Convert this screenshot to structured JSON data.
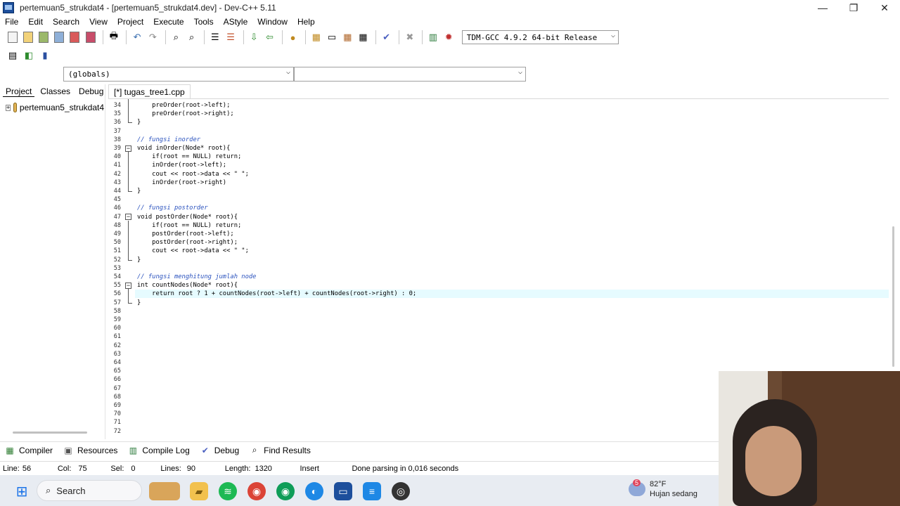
{
  "window": {
    "title": "pertemuan5_strukdat4 - [pertemuan5_strukdat4.dev] - Dev-C++ 5.11",
    "min_glyph": "—",
    "max_glyph": "❐",
    "close_glyph": "✕"
  },
  "menu": [
    "File",
    "Edit",
    "Search",
    "View",
    "Project",
    "Execute",
    "Tools",
    "AStyle",
    "Window",
    "Help"
  ],
  "toolbar": {
    "compiler": "TDM-GCC 4.9.2 64-bit Release"
  },
  "scope": {
    "left": "(globals)",
    "right": ""
  },
  "left_panel": {
    "tabs": [
      "Project",
      "Classes",
      "Debug"
    ],
    "project_name": "pertemuan5_strukdat4"
  },
  "editor": {
    "tab": "[*] tugas_tree1.cpp",
    "lines": [
      {
        "n": "34",
        "t": "    preOrder(root->left);"
      },
      {
        "n": "35",
        "t": "    preOrder(root->right);"
      },
      {
        "n": "36",
        "t": "}"
      },
      {
        "n": "37",
        "t": ""
      },
      {
        "n": "38",
        "t": "// fungsi inorder"
      },
      {
        "n": "39",
        "t": "void inOrder(Node* root){"
      },
      {
        "n": "40",
        "t": "    if(root == NULL) return;"
      },
      {
        "n": "41",
        "t": "    inOrder(root->left);"
      },
      {
        "n": "42",
        "t": "    cout << root->data << \" \";"
      },
      {
        "n": "43",
        "t": "    inOrder(root->right)"
      },
      {
        "n": "44",
        "t": "}"
      },
      {
        "n": "45",
        "t": ""
      },
      {
        "n": "46",
        "t": "// fungsi postorder"
      },
      {
        "n": "47",
        "t": "void postOrder(Node* root){"
      },
      {
        "n": "48",
        "t": "    if(root == NULL) return;"
      },
      {
        "n": "49",
        "t": "    postOrder(root->left);"
      },
      {
        "n": "50",
        "t": "    postOrder(root->right);"
      },
      {
        "n": "51",
        "t": "    cout << root->data << \" \";"
      },
      {
        "n": "52",
        "t": "}"
      },
      {
        "n": "53",
        "t": ""
      },
      {
        "n": "54",
        "t": "// fungsi menghitung jumlah node"
      },
      {
        "n": "55",
        "t": "int countNodes(Node* root){"
      },
      {
        "n": "56",
        "t": "    return root ? 1 + countNodes(root->left) + countNodes(root->right) : 0;"
      },
      {
        "n": "57",
        "t": "}"
      },
      {
        "n": "58",
        "t": ""
      },
      {
        "n": "59",
        "t": ""
      },
      {
        "n": "60",
        "t": ""
      },
      {
        "n": "61",
        "t": ""
      },
      {
        "n": "62",
        "t": ""
      },
      {
        "n": "63",
        "t": ""
      },
      {
        "n": "64",
        "t": ""
      },
      {
        "n": "65",
        "t": ""
      },
      {
        "n": "66",
        "t": ""
      },
      {
        "n": "67",
        "t": ""
      },
      {
        "n": "68",
        "t": ""
      },
      {
        "n": "69",
        "t": ""
      },
      {
        "n": "70",
        "t": ""
      },
      {
        "n": "71",
        "t": ""
      },
      {
        "n": "72",
        "t": ""
      }
    ]
  },
  "bottom_tabs": [
    "Compiler",
    "Resources",
    "Compile Log",
    "Debug",
    "Find Results"
  ],
  "status": {
    "line_label": "Line:",
    "line": "56",
    "col_label": "Col:",
    "col": "75",
    "sel_label": "Sel:",
    "sel": "0",
    "lines_label": "Lines:",
    "lines": "90",
    "length_label": "Length:",
    "length": "1320",
    "mode": "Insert",
    "message": "Done parsing in 0,016 seconds"
  },
  "taskbar": {
    "search": "Search",
    "temp": "82°F",
    "weather": "Hujan sedang",
    "badge": "5"
  },
  "colors": {
    "comment": "#2a52be",
    "highlight": "#e6fbff",
    "taskbar": "#e8ecf2"
  }
}
